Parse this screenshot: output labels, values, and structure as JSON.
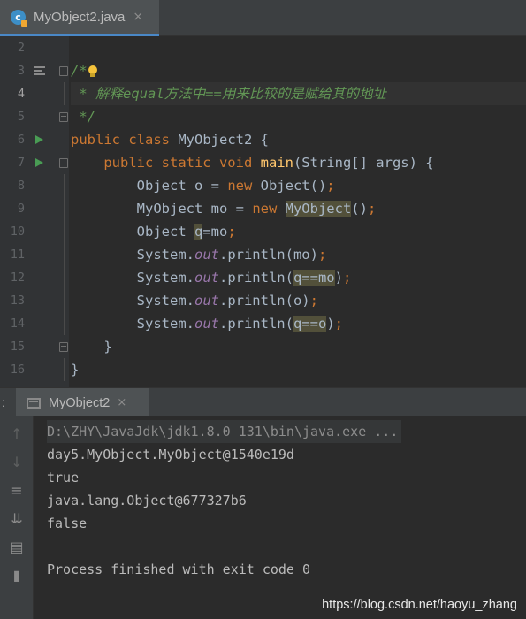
{
  "editor_tab": {
    "icon": "java-class-icon",
    "label": "MyObject2.java",
    "close": "×"
  },
  "gutter": {
    "line_numbers": [
      "2",
      "3",
      "4",
      "5",
      "6",
      "7",
      "8",
      "9",
      "10",
      "11",
      "12",
      "13",
      "14",
      "15",
      "16"
    ]
  },
  "code": {
    "l3_a": "/*",
    "l4": " * 解释equal方法中==用来比较的是赋给其的地址",
    "l5": " */",
    "l6_kw": "public class ",
    "l6_rest": "MyObject2 {",
    "l7_ind": "    ",
    "l7_kw": "public static void ",
    "l7_fn": "main",
    "l7_rest": "(String[] args) {",
    "l8_a": "        Object o = ",
    "l8_kw": "new ",
    "l8_b": "Object()",
    "l8_semi": ";",
    "l9_a": "        MyObject mo = ",
    "l9_kw": "new ",
    "l9_hl": "MyObject",
    "l9_b": "()",
    "l9_semi": ";",
    "l10_a": "        Object ",
    "l10_hl": "q",
    "l10_b": "=mo",
    "l10_semi": ";",
    "l11_a": "        System.",
    "l11_out": "out",
    "l11_b": ".println(mo)",
    "l11_semi": ";",
    "l12_a": "        System.",
    "l12_out": "out",
    "l12_b": ".println(",
    "l12_hl": "q==mo",
    "l12_c": ")",
    "l12_semi": ";",
    "l13_a": "        System.",
    "l13_out": "out",
    "l13_b": ".println(o)",
    "l13_semi": ";",
    "l14_a": "        System.",
    "l14_out": "out",
    "l14_b": ".println(",
    "l14_hl": "q==o",
    "l14_c": ")",
    "l14_semi": ";",
    "l15": "    }",
    "l16": "}"
  },
  "run_panel": {
    "colon": ":",
    "tab_label": "MyObject2",
    "tab_close": "×",
    "tools": [
      "up-arrow-icon",
      "down-arrow-icon",
      "soft-wrap-icon",
      "scroll-to-end-icon",
      "print-icon",
      "trash-icon"
    ]
  },
  "console_output": {
    "cmd": "D:\\ZHY\\JavaJdk\\jdk1.8.0_131\\bin\\java.exe ...",
    "line1": "day5.MyObject.MyObject@1540e19d",
    "line2": "true",
    "line3": "java.lang.Object@677327b6",
    "line4": "false",
    "line5": "",
    "line6": "Process finished with exit code 0"
  },
  "watermark": "https://blog.csdn.net/haoyu_zhang",
  "colors": {
    "keyword": "#cc7832",
    "comment": "#629755",
    "method": "#ffc66d",
    "static_field": "#9876aa",
    "background": "#2b2b2b"
  }
}
